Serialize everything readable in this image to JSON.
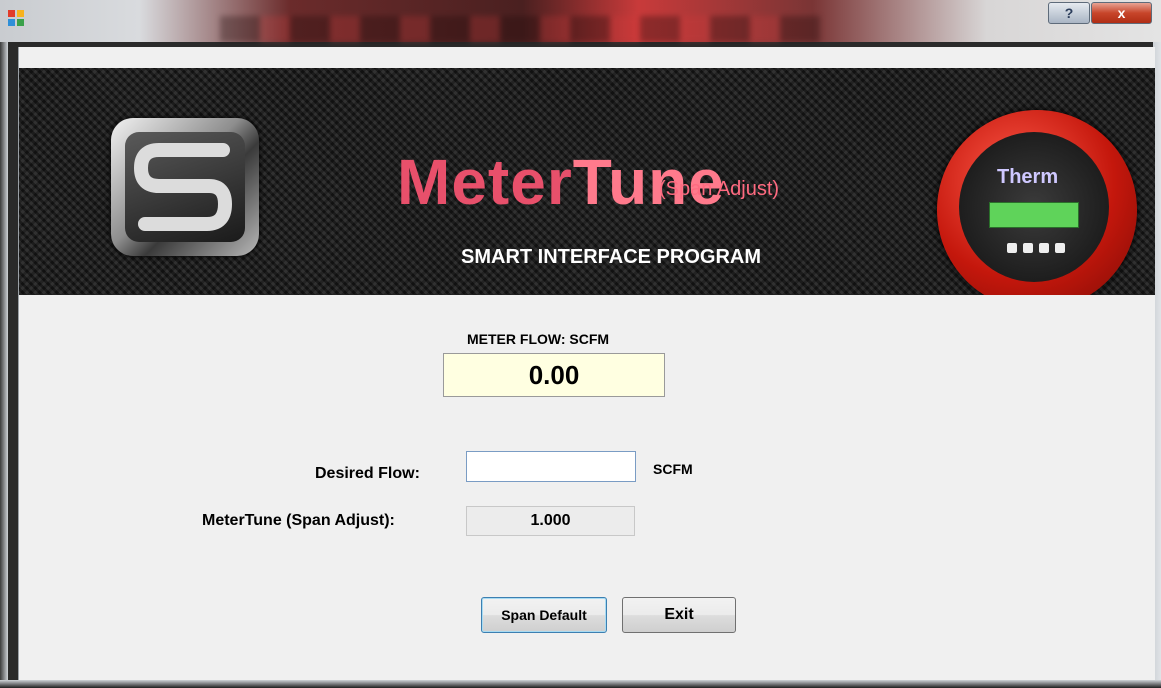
{
  "window": {
    "title": "",
    "help_label": "?",
    "close_label": "x"
  },
  "banner": {
    "title_part1": "Meter",
    "title_part2": "Tune",
    "subtitle": "(Span Adjust)",
    "tagline": "SMART INTERFACE PROGRAM",
    "device_brand": "Therm"
  },
  "flow": {
    "label": "METER FLOW: SCFM",
    "value": "0.00"
  },
  "desired": {
    "label": "Desired Flow:",
    "value": "",
    "unit": "SCFM"
  },
  "span": {
    "label": "MeterTune (Span Adjust):",
    "value": "1.000"
  },
  "buttons": {
    "span_default": "Span Default",
    "exit": "Exit"
  },
  "colors": {
    "accent_red": "#e8506b",
    "display_bg": "#ffffe1",
    "close_red": "#c7452a"
  }
}
